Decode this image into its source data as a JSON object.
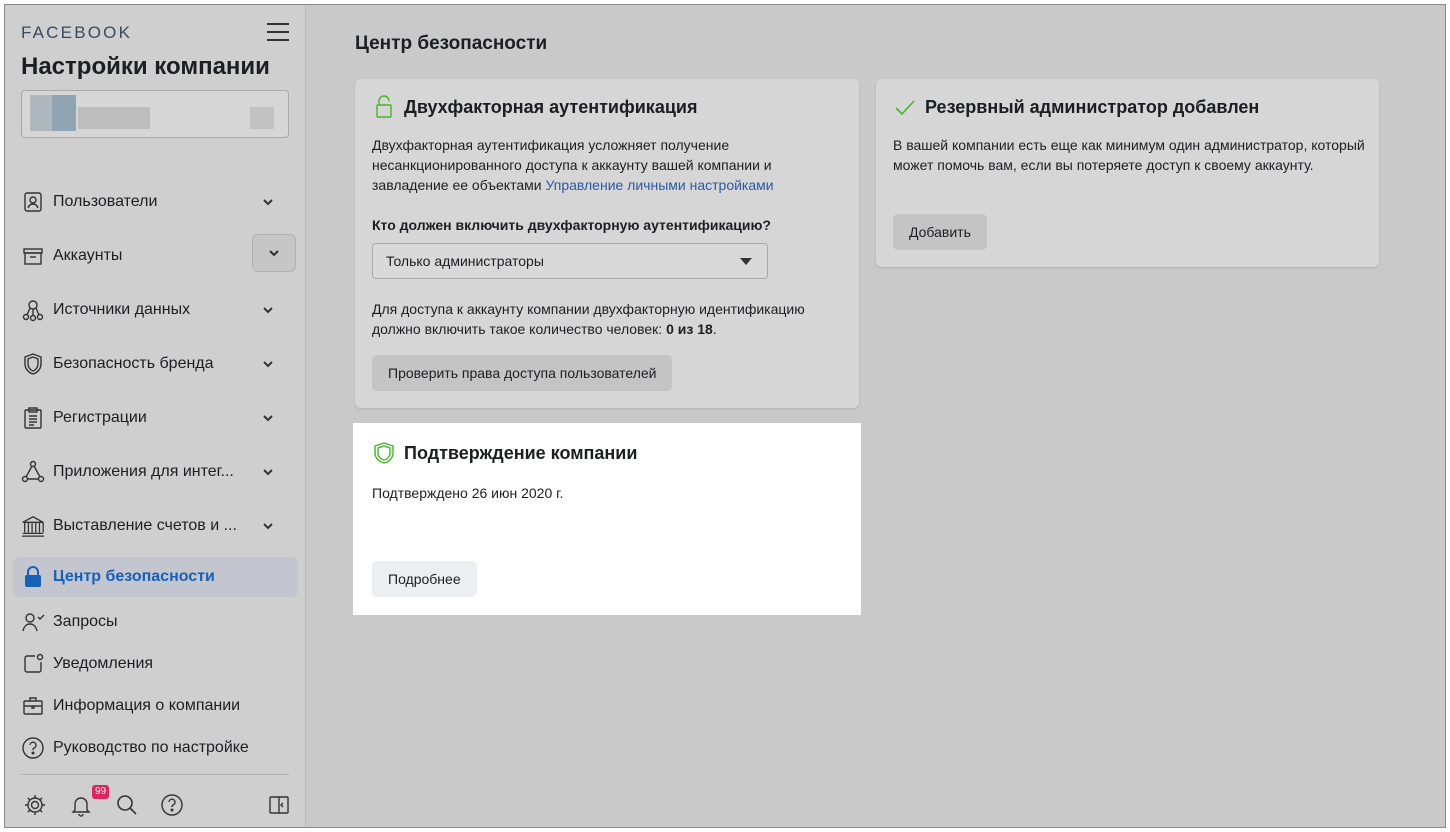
{
  "sidebar": {
    "brand": "FACEBOOK",
    "title": "Настройки компании",
    "items": [
      {
        "label": "Пользователи",
        "icon": "users-icon"
      },
      {
        "label": "Аккаунты",
        "icon": "accounts-icon"
      },
      {
        "label": "Источники данных",
        "icon": "data-sources-icon"
      },
      {
        "label": "Безопасность бренда",
        "icon": "shield-icon"
      },
      {
        "label": "Регистрации",
        "icon": "clipboard-icon"
      },
      {
        "label": "Приложения для интег...",
        "icon": "integrations-icon"
      },
      {
        "label": "Выставление счетов и ...",
        "icon": "billing-icon"
      },
      {
        "label": "Центр безопасности",
        "icon": "lock-icon"
      },
      {
        "label": "Запросы",
        "icon": "requests-icon"
      },
      {
        "label": "Уведомления",
        "icon": "notifications-icon"
      },
      {
        "label": "Информация о компании",
        "icon": "briefcase-icon"
      },
      {
        "label": "Руководство по настройке",
        "icon": "help-icon"
      }
    ],
    "notification_count": "99"
  },
  "main": {
    "page_title": "Центр безопасности",
    "two_factor": {
      "title": "Двухфакторная аутентификация",
      "desc": "Двухфакторная аутентификация усложняет получение несанкционированного доступа к аккаунту вашей компании и завладение ее объектами",
      "link": "Управление личными настройками",
      "question": "Кто должен включить двухфакторную аутентификацию?",
      "select_value": "Только администраторы",
      "access_text": "Для доступа к аккаунту компании двухфакторную идентификацию должно включить такое количество человек:",
      "access_count": "0 из 18",
      "button": "Проверить права доступа пользователей"
    },
    "backup_admin": {
      "title": "Резервный администратор добавлен",
      "desc": "В вашей компании есть еще как минимум один администратор, который может помочь вам, если вы потеряете доступ к своему аккаунту.",
      "button": "Добавить"
    },
    "verification": {
      "title": "Подтверждение компании",
      "status": "Подтверждено 26 июн 2020 г.",
      "button": "Подробнее"
    }
  },
  "colors": {
    "accent_blue": "#1660b8",
    "success_green": "#42b72a",
    "badge_red": "#e0245e"
  }
}
